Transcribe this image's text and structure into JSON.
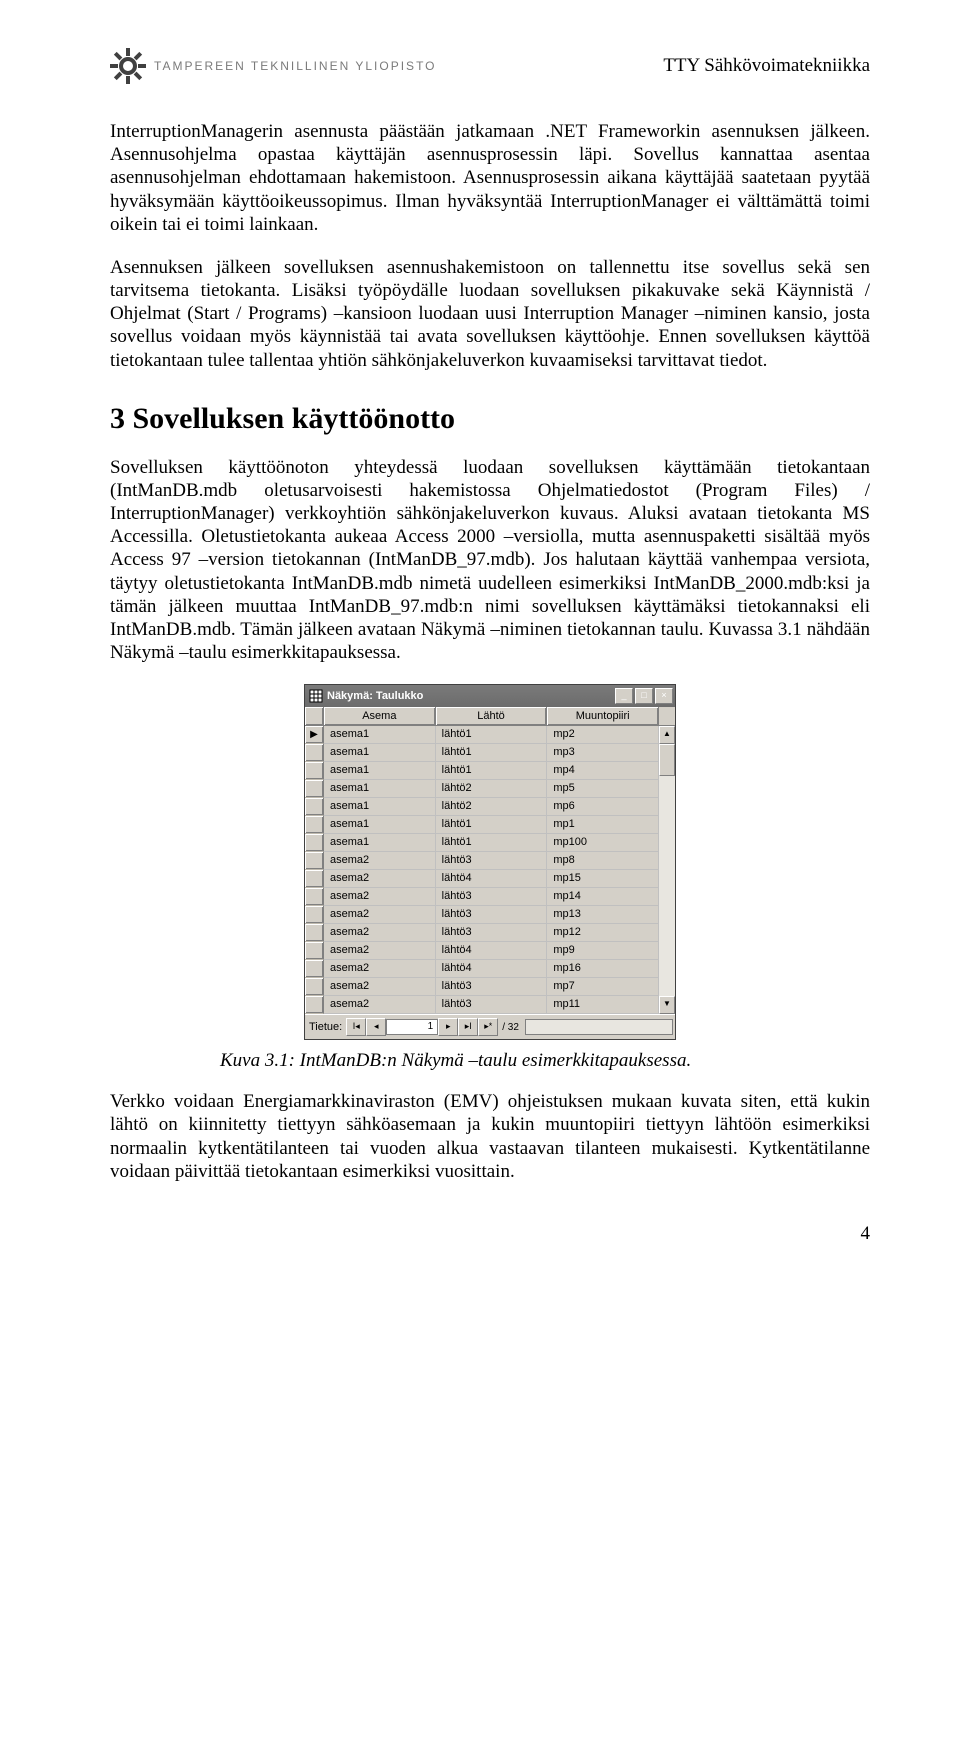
{
  "header": {
    "university": "TAMPEREEN TEKNILLINEN YLIOPISTO",
    "department": "TTY Sähkövoimatekniikka"
  },
  "body": {
    "p1": "InterruptionManagerin asennusta päästään jatkamaan .NET Frameworkin asennuksen jälkeen. Asennusohjelma opastaa käyttäjän asennusprosessin läpi. Sovellus kannattaa asentaa asennusohjelman ehdottamaan hakemistoon. Asennusprosessin aikana käyttäjää saatetaan pyytää hyväksymään käyttöoikeussopimus. Ilman hyväksyntää InterruptionManager ei välttämättä toimi oikein tai ei toimi lainkaan.",
    "p2": "Asennuksen jälkeen sovelluksen asennushakemistoon on tallennettu itse sovellus sekä sen tarvitsema tietokanta. Lisäksi työpöydälle luodaan sovelluksen pikakuvake sekä Käynnistä / Ohjelmat (Start / Programs) –kansioon luodaan uusi Interruption Manager –niminen kansio, josta sovellus voidaan myös käynnistää tai avata sovelluksen käyttöohje. Ennen sovelluksen käyttöä tietokantaan tulee tallentaa yhtiön sähkönjakeluverkon kuvaamiseksi tarvittavat tiedot.",
    "h3": "3 Sovelluksen käyttöönotto",
    "p3": "Sovelluksen käyttöönoton yhteydessä luodaan sovelluksen käyttämään tietokantaan (IntManDB.mdb oletusarvoisesti hakemistossa Ohjelmatiedostot (Program Files) / InterruptionManager) verkkoyhtiön sähkönjakeluverkon kuvaus. Aluksi avataan tietokanta MS Accessilla. Oletustietokanta aukeaa Access 2000 –versiolla, mutta asennuspaketti sisältää myös Access 97 –version tietokannan (IntManDB_97.mdb). Jos halutaan käyttää vanhempaa versiota, täytyy oletustietokanta IntManDB.mdb nimetä uudelleen esimerkiksi IntManDB_2000.mdb:ksi ja tämän jälkeen muuttaa IntManDB_97.mdb:n nimi sovelluksen käyttämäksi tietokannaksi eli IntManDB.mdb. Tämän jälkeen avataan Näkymä –niminen tietokannan taulu. Kuvassa 3.1 nähdään Näkymä –taulu esimerkkitapauksessa.",
    "caption": "Kuva 3.1: IntManDB:n Näkymä –taulu esimerkkitapauksessa.",
    "p4": "Verkko voidaan Energiamarkkinaviraston (EMV) ohjeistuksen mukaan kuvata siten, että kukin lähtö on kiinnitetty tiettyyn sähköasemaan ja kukin muuntopiiri tiettyyn lähtöön esimerkiksi normaalin kytkentätilanteen tai vuoden alkua vastaavan tilanteen mukaisesti. Kytkentätilanne voidaan päivittää tietokantaan esimerkiksi vuosittain.",
    "page_number": "4"
  },
  "access": {
    "title": "Näkymä: Taulukko",
    "columns": [
      "Asema",
      "Lähtö",
      "Muuntopiiri"
    ],
    "rows": [
      {
        "asema": "asema1",
        "lahto": "lähtö1",
        "mp": "mp2",
        "selected": true
      },
      {
        "asema": "asema1",
        "lahto": "lähtö1",
        "mp": "mp3"
      },
      {
        "asema": "asema1",
        "lahto": "lähtö1",
        "mp": "mp4"
      },
      {
        "asema": "asema1",
        "lahto": "lähtö2",
        "mp": "mp5"
      },
      {
        "asema": "asema1",
        "lahto": "lähtö2",
        "mp": "mp6"
      },
      {
        "asema": "asema1",
        "lahto": "lähtö1",
        "mp": "mp1"
      },
      {
        "asema": "asema1",
        "lahto": "lähtö1",
        "mp": "mp100"
      },
      {
        "asema": "asema2",
        "lahto": "lähtö3",
        "mp": "mp8"
      },
      {
        "asema": "asema2",
        "lahto": "lähtö4",
        "mp": "mp15"
      },
      {
        "asema": "asema2",
        "lahto": "lähtö3",
        "mp": "mp14"
      },
      {
        "asema": "asema2",
        "lahto": "lähtö3",
        "mp": "mp13"
      },
      {
        "asema": "asema2",
        "lahto": "lähtö3",
        "mp": "mp12"
      },
      {
        "asema": "asema2",
        "lahto": "lähtö4",
        "mp": "mp9"
      },
      {
        "asema": "asema2",
        "lahto": "lähtö4",
        "mp": "mp16"
      },
      {
        "asema": "asema2",
        "lahto": "lähtö3",
        "mp": "mp7"
      },
      {
        "asema": "asema2",
        "lahto": "lähtö3",
        "mp": "mp11"
      }
    ],
    "nav": {
      "label": "Tietue:",
      "current": "1",
      "total": "/ 32"
    }
  }
}
